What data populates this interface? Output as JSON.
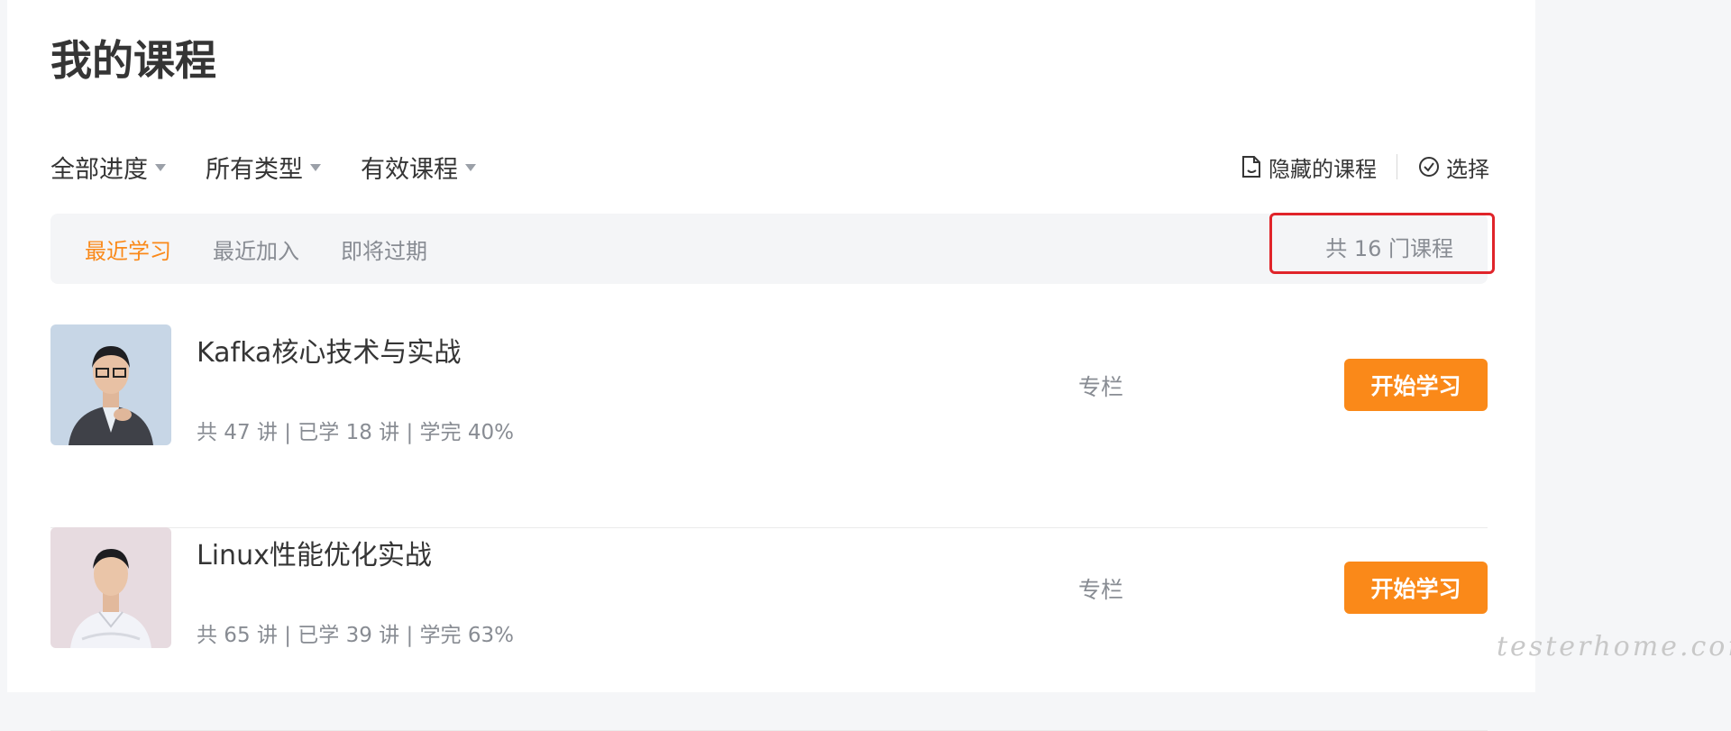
{
  "page": {
    "title": "我的课程"
  },
  "filters": [
    {
      "label": "全部进度"
    },
    {
      "label": "所有类型"
    },
    {
      "label": "有效课程"
    }
  ],
  "tools": {
    "hidden_label": "隐藏的课程",
    "select_label": "选择"
  },
  "tabs": [
    {
      "label": "最近学习",
      "active": true
    },
    {
      "label": "最近加入",
      "active": false
    },
    {
      "label": "即将过期",
      "active": false
    }
  ],
  "course_count_text": "共 16 门课程",
  "courses": [
    {
      "title": "Kafka核心技术与实战",
      "meta": "共 47 讲 | 已学 18 讲 | 学完 40%",
      "type": "专栏",
      "button": "开始学习",
      "thumb_bg": "#c7d6e6"
    },
    {
      "title": "Linux性能优化实战",
      "meta": "共 65 讲 | 已学 39 讲 | 学完 63%",
      "type": "专栏",
      "button": "开始学习",
      "thumb_bg": "#e7dbe0"
    }
  ],
  "watermark": "testerhome.com",
  "colors": {
    "accent": "#fa8919",
    "highlight_box": "#e0242a",
    "muted_text": "#888c93"
  }
}
